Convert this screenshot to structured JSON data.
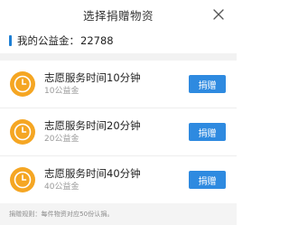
{
  "dialog": {
    "title": "选择捐赠物资",
    "close_icon": "close-icon"
  },
  "balance": {
    "label": "我的公益金：",
    "value": "22788",
    "accent_color": "#1e7fd4"
  },
  "items": [
    {
      "icon": "clock-icon",
      "title": "志愿服务时间10分钟",
      "cost": "10公益金",
      "button_label": "捐赠"
    },
    {
      "icon": "clock-icon",
      "title": "志愿服务时间20分钟",
      "cost": "20公益金",
      "button_label": "捐赠"
    },
    {
      "icon": "clock-icon",
      "title": "志愿服务时间40分钟",
      "cost": "40公益金",
      "button_label": "捐赠"
    }
  ],
  "footer": {
    "note": "捐赠规则：每件物资对应50份认捐。"
  },
  "colors": {
    "button": "#2e8ae0",
    "clock": "#f5a623"
  }
}
